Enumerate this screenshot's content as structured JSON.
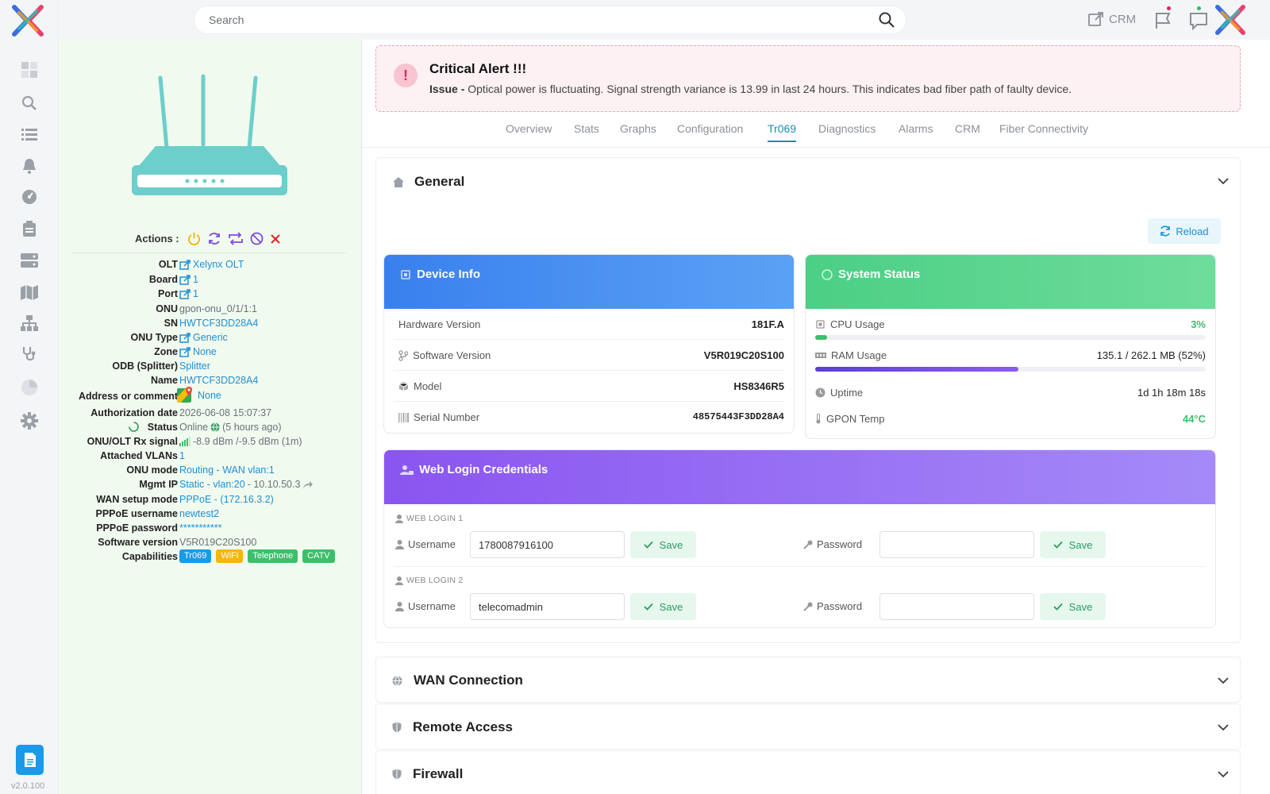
{
  "sidebar": {
    "version": "v2.0.100",
    "items": [
      "dashboard-icon",
      "search-devices-icon",
      "list-icon",
      "bell-icon",
      "gauge-icon",
      "clipboard-icon",
      "server-icon",
      "map-icon",
      "network-icon",
      "stethoscope-icon",
      "pie-chart-icon",
      "gear-icon"
    ]
  },
  "topbar": {
    "search_placeholder": "Search",
    "crm_label": "CRM"
  },
  "device": {
    "actions_label": "Actions :",
    "properties": [
      {
        "key": "OLT",
        "value": "Xelynx OLT"
      },
      {
        "key": "Board",
        "value": "1"
      },
      {
        "key": "Port",
        "value": "1"
      },
      {
        "key": "ONU",
        "value": "gpon-onu_0/1/1:1"
      },
      {
        "key": "SN",
        "value": "HWTCF3DD28A4"
      },
      {
        "key": "ONU Type",
        "value": "Generic"
      },
      {
        "key": "Zone",
        "value": "None"
      },
      {
        "key": "ODB (Splitter)",
        "value": "Splitter"
      },
      {
        "key": "Name",
        "value": "HWTCF3DD28A4"
      },
      {
        "key": "Address or comment",
        "value": "None"
      },
      {
        "key": "Authorization date",
        "value": "2026-06-08 15:07:37"
      },
      {
        "key": "Status",
        "value": "Online",
        "extra": "(5 hours ago)"
      },
      {
        "key": "ONU/OLT Rx signal",
        "value": "-8.9 dBm /-9.5 dBm (1m)"
      },
      {
        "key": "Attached VLANs",
        "value": "1"
      },
      {
        "key": "ONU mode",
        "value": "Routing - WAN vlan:1"
      },
      {
        "key": "Mgmt IP",
        "value": "Static - vlan:20",
        "extra": " - 10.10.50.3"
      },
      {
        "key": "WAN setup mode",
        "value": "PPPoE - (172.16.3.2)"
      },
      {
        "key": "PPPoE username",
        "value": "newtest2"
      },
      {
        "key": "PPPoE password",
        "value": "***********"
      },
      {
        "key": "Software version",
        "value": "V5R019C20S100"
      },
      {
        "key": "Capabilities",
        "value": ""
      }
    ],
    "capabilities": [
      {
        "label": "Tr069",
        "color": "#1a9ae8"
      },
      {
        "label": "WiFi",
        "color": "#f5b70f"
      },
      {
        "label": "Telephone",
        "color": "#3dbf6a"
      },
      {
        "label": "CATV",
        "color": "#3dbf6a"
      }
    ]
  },
  "alert": {
    "title": "Critical Alert !!!",
    "issue_label": "Issue -",
    "message": "Optical power is fluctuating. Signal strength variance is 13.99 in last 24 hours. This indicates bad fiber path of faulty device."
  },
  "tabs": [
    "Overview",
    "Stats",
    "Graphs",
    "Configuration",
    "Tr069",
    "Diagnostics",
    "Alarms",
    "CRM",
    "Fiber Connectivity"
  ],
  "active_tab": "Tr069",
  "general": {
    "title": "General",
    "reload_label": "Reload",
    "device_info": {
      "title": "Device Info",
      "rows": [
        {
          "label": "Hardware Version",
          "value": "181F.A"
        },
        {
          "label": "Software Version",
          "value": "V5R019C20S100"
        },
        {
          "label": "Model",
          "value": "HS8346R5"
        },
        {
          "label": "Serial Number",
          "value": "48575443F3DD28A4"
        }
      ]
    },
    "system_status": {
      "title": "System Status",
      "cpu_label": "CPU Usage",
      "cpu_value": "3%",
      "cpu_pct": 3,
      "ram_label": "RAM Usage",
      "ram_value": "135.1 / 262.1 MB (52%)",
      "ram_pct": 52,
      "uptime_label": "Uptime",
      "uptime_value": "1d 1h 18m 18s",
      "temp_label": "GPON Temp",
      "temp_value": "44°C"
    },
    "web_login": {
      "title": "Web Login Credentials",
      "logins": [
        {
          "label": "WEB LOGIN 1",
          "username_label": "Username",
          "username": "1780087916100",
          "password_label": "Password",
          "password": "",
          "save_label": "Save"
        },
        {
          "label": "WEB LOGIN 2",
          "username_label": "Username",
          "username": "telecomadmin",
          "password_label": "Password",
          "password": "",
          "save_label": "Save"
        }
      ]
    }
  },
  "sections": [
    {
      "title": "WAN Connection",
      "icon": "globe-icon"
    },
    {
      "title": "Remote Access",
      "icon": "shield-icon"
    },
    {
      "title": "Firewall",
      "icon": "shield-icon"
    }
  ],
  "colors": {
    "accent": "#1a8fd6",
    "device_info_header": "#3f86f0",
    "system_status_header": "#4fd18a",
    "web_login_header": "#8b5cf6",
    "alert_bg": "#fdf1f3"
  }
}
